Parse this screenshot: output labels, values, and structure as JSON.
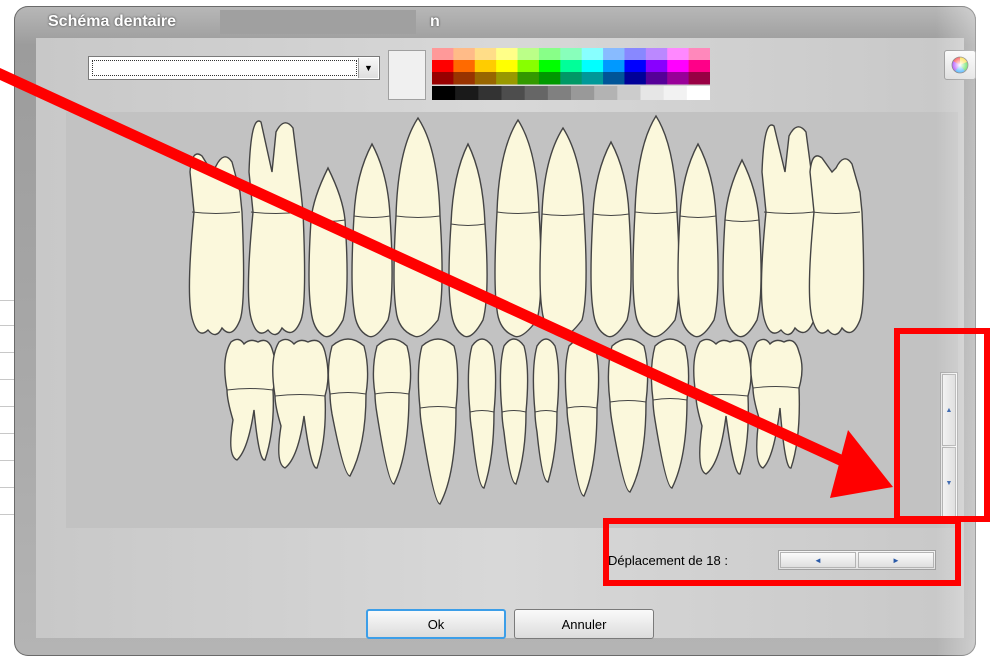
{
  "window": {
    "title": "Schéma dentaire",
    "title_suffix": "n"
  },
  "toolbar": {
    "combo_value": "",
    "colors": {
      "top_row": [
        "#ff9999",
        "#ffbb88",
        "#ffdd88",
        "#ffff88",
        "#bbff88",
        "#88ff88",
        "#88ffbb",
        "#88ffff",
        "#88bbff",
        "#8888ff",
        "#bb88ff",
        "#ff88ff",
        "#ff88bb"
      ],
      "mid_row": [
        "#ff0000",
        "#ff6a00",
        "#ffcc00",
        "#ffff00",
        "#88ff00",
        "#00ff00",
        "#00ff99",
        "#00ffff",
        "#0099ff",
        "#0000ff",
        "#8800ff",
        "#ff00ff",
        "#ff0088"
      ],
      "dark_row": [
        "#990000",
        "#993300",
        "#996600",
        "#999900",
        "#339900",
        "#009900",
        "#009966",
        "#009999",
        "#005599",
        "#000099",
        "#550099",
        "#990099",
        "#990044"
      ],
      "gray_row": [
        "#000000",
        "#1a1a1a",
        "#333333",
        "#4d4d4d",
        "#666666",
        "#808080",
        "#999999",
        "#b3b3b3",
        "#cccccc",
        "#e6e6e6",
        "#f2f2f2",
        "#ffffff"
      ]
    }
  },
  "scroll_label": "Déplacement de 18 :",
  "buttons": {
    "ok": "Ok",
    "cancel": "Annuler"
  },
  "icons": {
    "dropdown": "chevron-down-icon",
    "scroll_up": "arrow-up-icon",
    "scroll_down": "arrow-down-icon",
    "scroll_left": "arrow-left-icon",
    "scroll_right": "arrow-right-icon",
    "color_picker": "color-wheel-icon"
  },
  "annotation_color": "#ff0000"
}
